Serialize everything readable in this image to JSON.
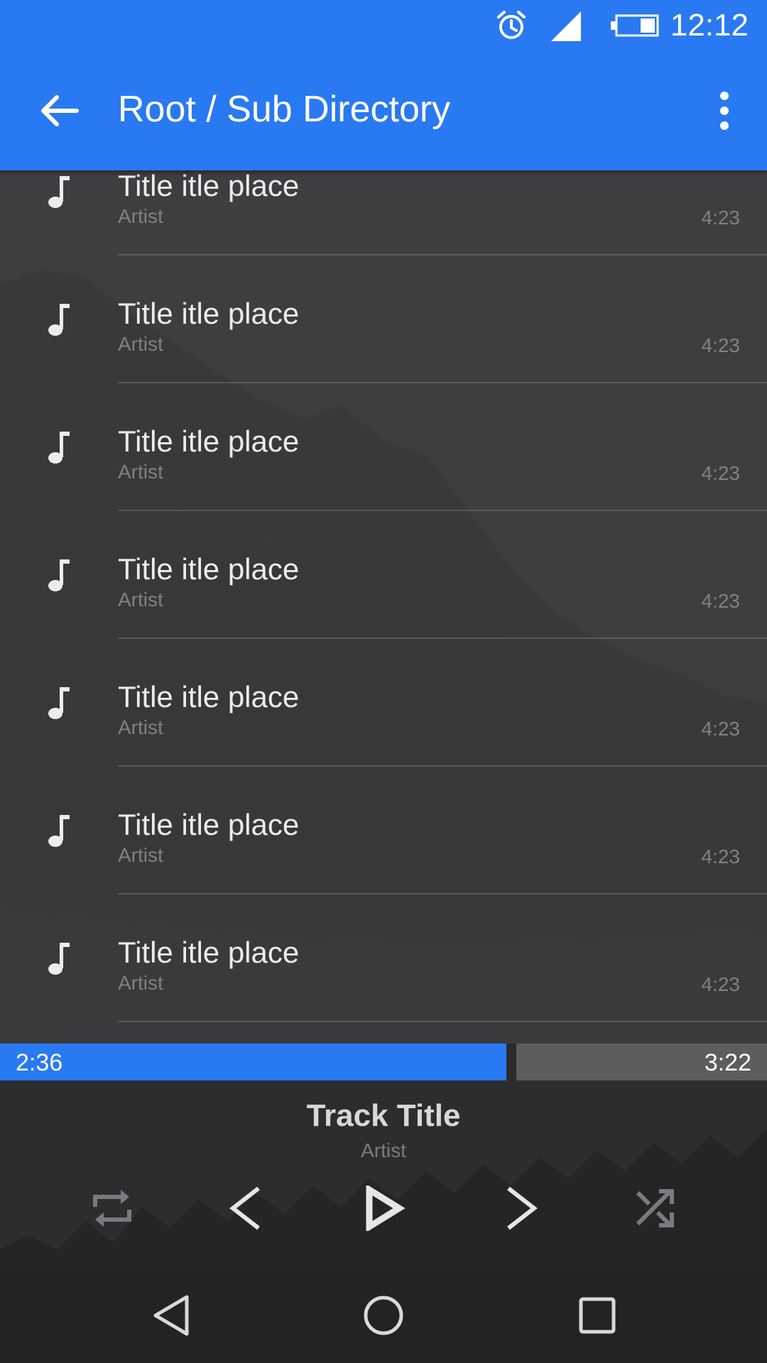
{
  "status_bar": {
    "time": "12:12",
    "icons": [
      "alarm-clock-icon",
      "cell-signal-icon",
      "battery-icon"
    ]
  },
  "app_bar": {
    "title": "Root / Sub Directory",
    "back_icon": "arrow-left-icon",
    "menu_icon": "more-vertical-icon"
  },
  "tracks": [
    {
      "title": "Title itle place",
      "artist": "Artist",
      "duration": "4:23"
    },
    {
      "title": "Title itle place",
      "artist": "Artist",
      "duration": "4:23"
    },
    {
      "title": "Title itle place",
      "artist": "Artist",
      "duration": "4:23"
    },
    {
      "title": "Title itle place",
      "artist": "Artist",
      "duration": "4:23"
    },
    {
      "title": "Title itle place",
      "artist": "Artist",
      "duration": "4:23"
    },
    {
      "title": "Title itle place",
      "artist": "Artist",
      "duration": "4:23"
    },
    {
      "title": "Title itle place",
      "artist": "Artist",
      "duration": "4:23"
    }
  ],
  "progress": {
    "elapsed": "2:36",
    "total": "3:22",
    "fraction": 0.66
  },
  "now_playing": {
    "title": "Track Title",
    "artist": "Artist"
  },
  "controls": [
    "repeat-icon",
    "previous-icon",
    "play-icon",
    "next-icon",
    "shuffle-icon"
  ],
  "nav_bar": [
    "nav-back-icon",
    "nav-home-icon",
    "nav-recents-icon"
  ],
  "colors": {
    "accent": "#2979f2",
    "background": "#3a3b3d",
    "player_background": "#2c2d2f"
  }
}
